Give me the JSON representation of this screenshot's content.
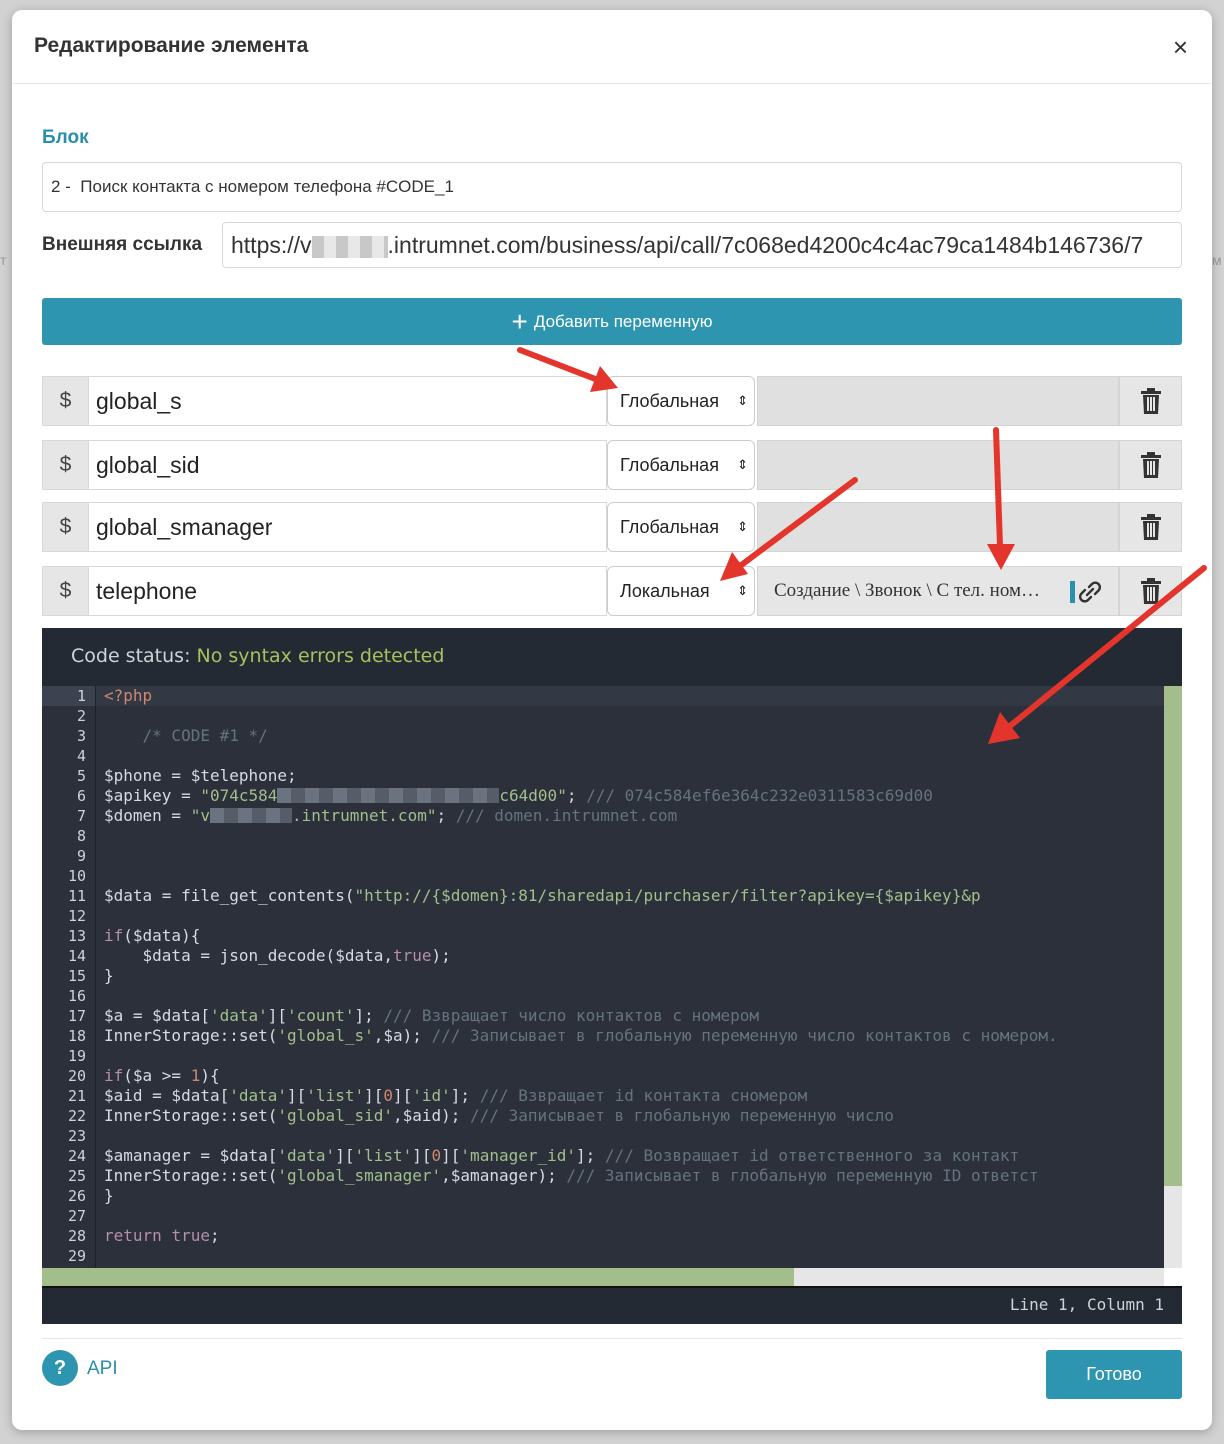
{
  "modal": {
    "title": "Редактирование элемента",
    "close_glyph": "×"
  },
  "block": {
    "label": "Блок",
    "value": "2 -  Поиск контакта с номером телефона #CODE_1"
  },
  "external_link": {
    "label": "Внешняя ссылка",
    "value_prefix": "https://v",
    "value_suffix": ".intrumnet.com/business/api/call/7c068ed4200c4c4ac79ca1484b146736/7"
  },
  "add_variable_button": {
    "label": "Добавить переменную",
    "icon": "plus-icon"
  },
  "variables": [
    {
      "symbol": "$",
      "name": "global_s",
      "scope": "Глобальная",
      "value": ""
    },
    {
      "symbol": "$",
      "name": "global_sid",
      "scope": "Глобальная",
      "value": ""
    },
    {
      "symbol": "$",
      "name": "global_smanager",
      "scope": "Глобальная",
      "value": ""
    },
    {
      "symbol": "$",
      "name": "telephone",
      "scope": "Локальная",
      "value": "Создание \\ Звонок \\ С тел. ном…"
    }
  ],
  "select_arrow_glyph": "⇕",
  "editor": {
    "status_label": "Code status:",
    "status_value": "No syntax errors detected",
    "position": "Line 1, Column 1",
    "line_numbers": [
      "1",
      "2",
      "3",
      "4",
      "5",
      "6",
      "7",
      "8",
      "9",
      "10",
      "11",
      "12",
      "13",
      "14",
      "15",
      "16",
      "17",
      "18",
      "19",
      "20",
      "21",
      "22",
      "23",
      "24",
      "25",
      "26",
      "27",
      "28",
      "29"
    ],
    "tokens": {
      "l1_open": "<?php",
      "l3_comment": "    /* CODE #1 */",
      "l5": "$phone = $telephone;",
      "l6_a": "$apikey = ",
      "l6_str1": "\"074c584",
      "l6_str2": "c64d00\"",
      "l6_semi": "; ",
      "l6_comment": "/// 074c584ef6e364c232e0311583c69d00",
      "l7_a": "$domen = ",
      "l7_str1": "\"v",
      "l7_str2": ".intrumnet.com\"",
      "l7_semi": "; ",
      "l7_comment": "/// domen.intrumnet.com",
      "l11_a": "$data = file_get_contents(",
      "l11_str": "\"http://{$domen}:81/sharedapi/purchaser/filter?apikey={$apikey}&p",
      "l13_kw": "if",
      "l13_rest": "($data){",
      "l14_a": "    $data = json_decode($data,",
      "l14_bool": "true",
      "l14_b": ");",
      "l15": "}",
      "l17_a": "$a = $data[",
      "l17_s1": "'data'",
      "l17_b": "][",
      "l17_s2": "'count'",
      "l17_c": "]; ",
      "l17_comment": "/// Взвращает число контактов с номером",
      "l18_a": "InnerStorage::set(",
      "l18_s1": "'global_s'",
      "l18_b": ",$a); ",
      "l18_comment": "/// Записывает в глобальную переменную число контактов с номером.",
      "l20_kw": "if",
      "l20_a": "($a >= ",
      "l20_num": "1",
      "l20_b": "){",
      "l21_a": "$aid = $data[",
      "l21_s1": "'data'",
      "l21_b": "][",
      "l21_s2": "'list'",
      "l21_c": "][",
      "l21_num": "0",
      "l21_d": "][",
      "l21_s3": "'id'",
      "l21_e": "]; ",
      "l21_comment": "/// Взвращает id контакта снoмером",
      "l22_a": "InnerStorage::set(",
      "l22_s1": "'global_sid'",
      "l22_b": ",$aid); ",
      "l22_comment": "/// Записывает в глобальную переменную число",
      "l24_a": "$amanager = $data[",
      "l24_s1": "'data'",
      "l24_b": "][",
      "l24_s2": "'list'",
      "l24_c": "][",
      "l24_num": "0",
      "l24_d": "][",
      "l24_s3": "'manager_id'",
      "l24_e": "]; ",
      "l24_comment": "/// Возвращает id ответственного за контакт",
      "l25_a": "InnerStorage::set(",
      "l25_s1": "'global_smanager'",
      "l25_b": ",$amanager); ",
      "l25_comment": "/// Записывает в глобальную переменную ID ответст",
      "l26": "}",
      "l28_kw": "return",
      "l28_sp": " ",
      "l28_bool": "true",
      "l28_semi": ";"
    }
  },
  "footer": {
    "help_glyph": "?",
    "api_label": "API",
    "done_label": "Готово"
  },
  "colors": {
    "accent": "#2e95b0",
    "label_accent": "#2a8fab",
    "annotation_arrow": "#e3352b",
    "editor_bg": "#2b303b",
    "status_ok": "#a5c25c"
  }
}
